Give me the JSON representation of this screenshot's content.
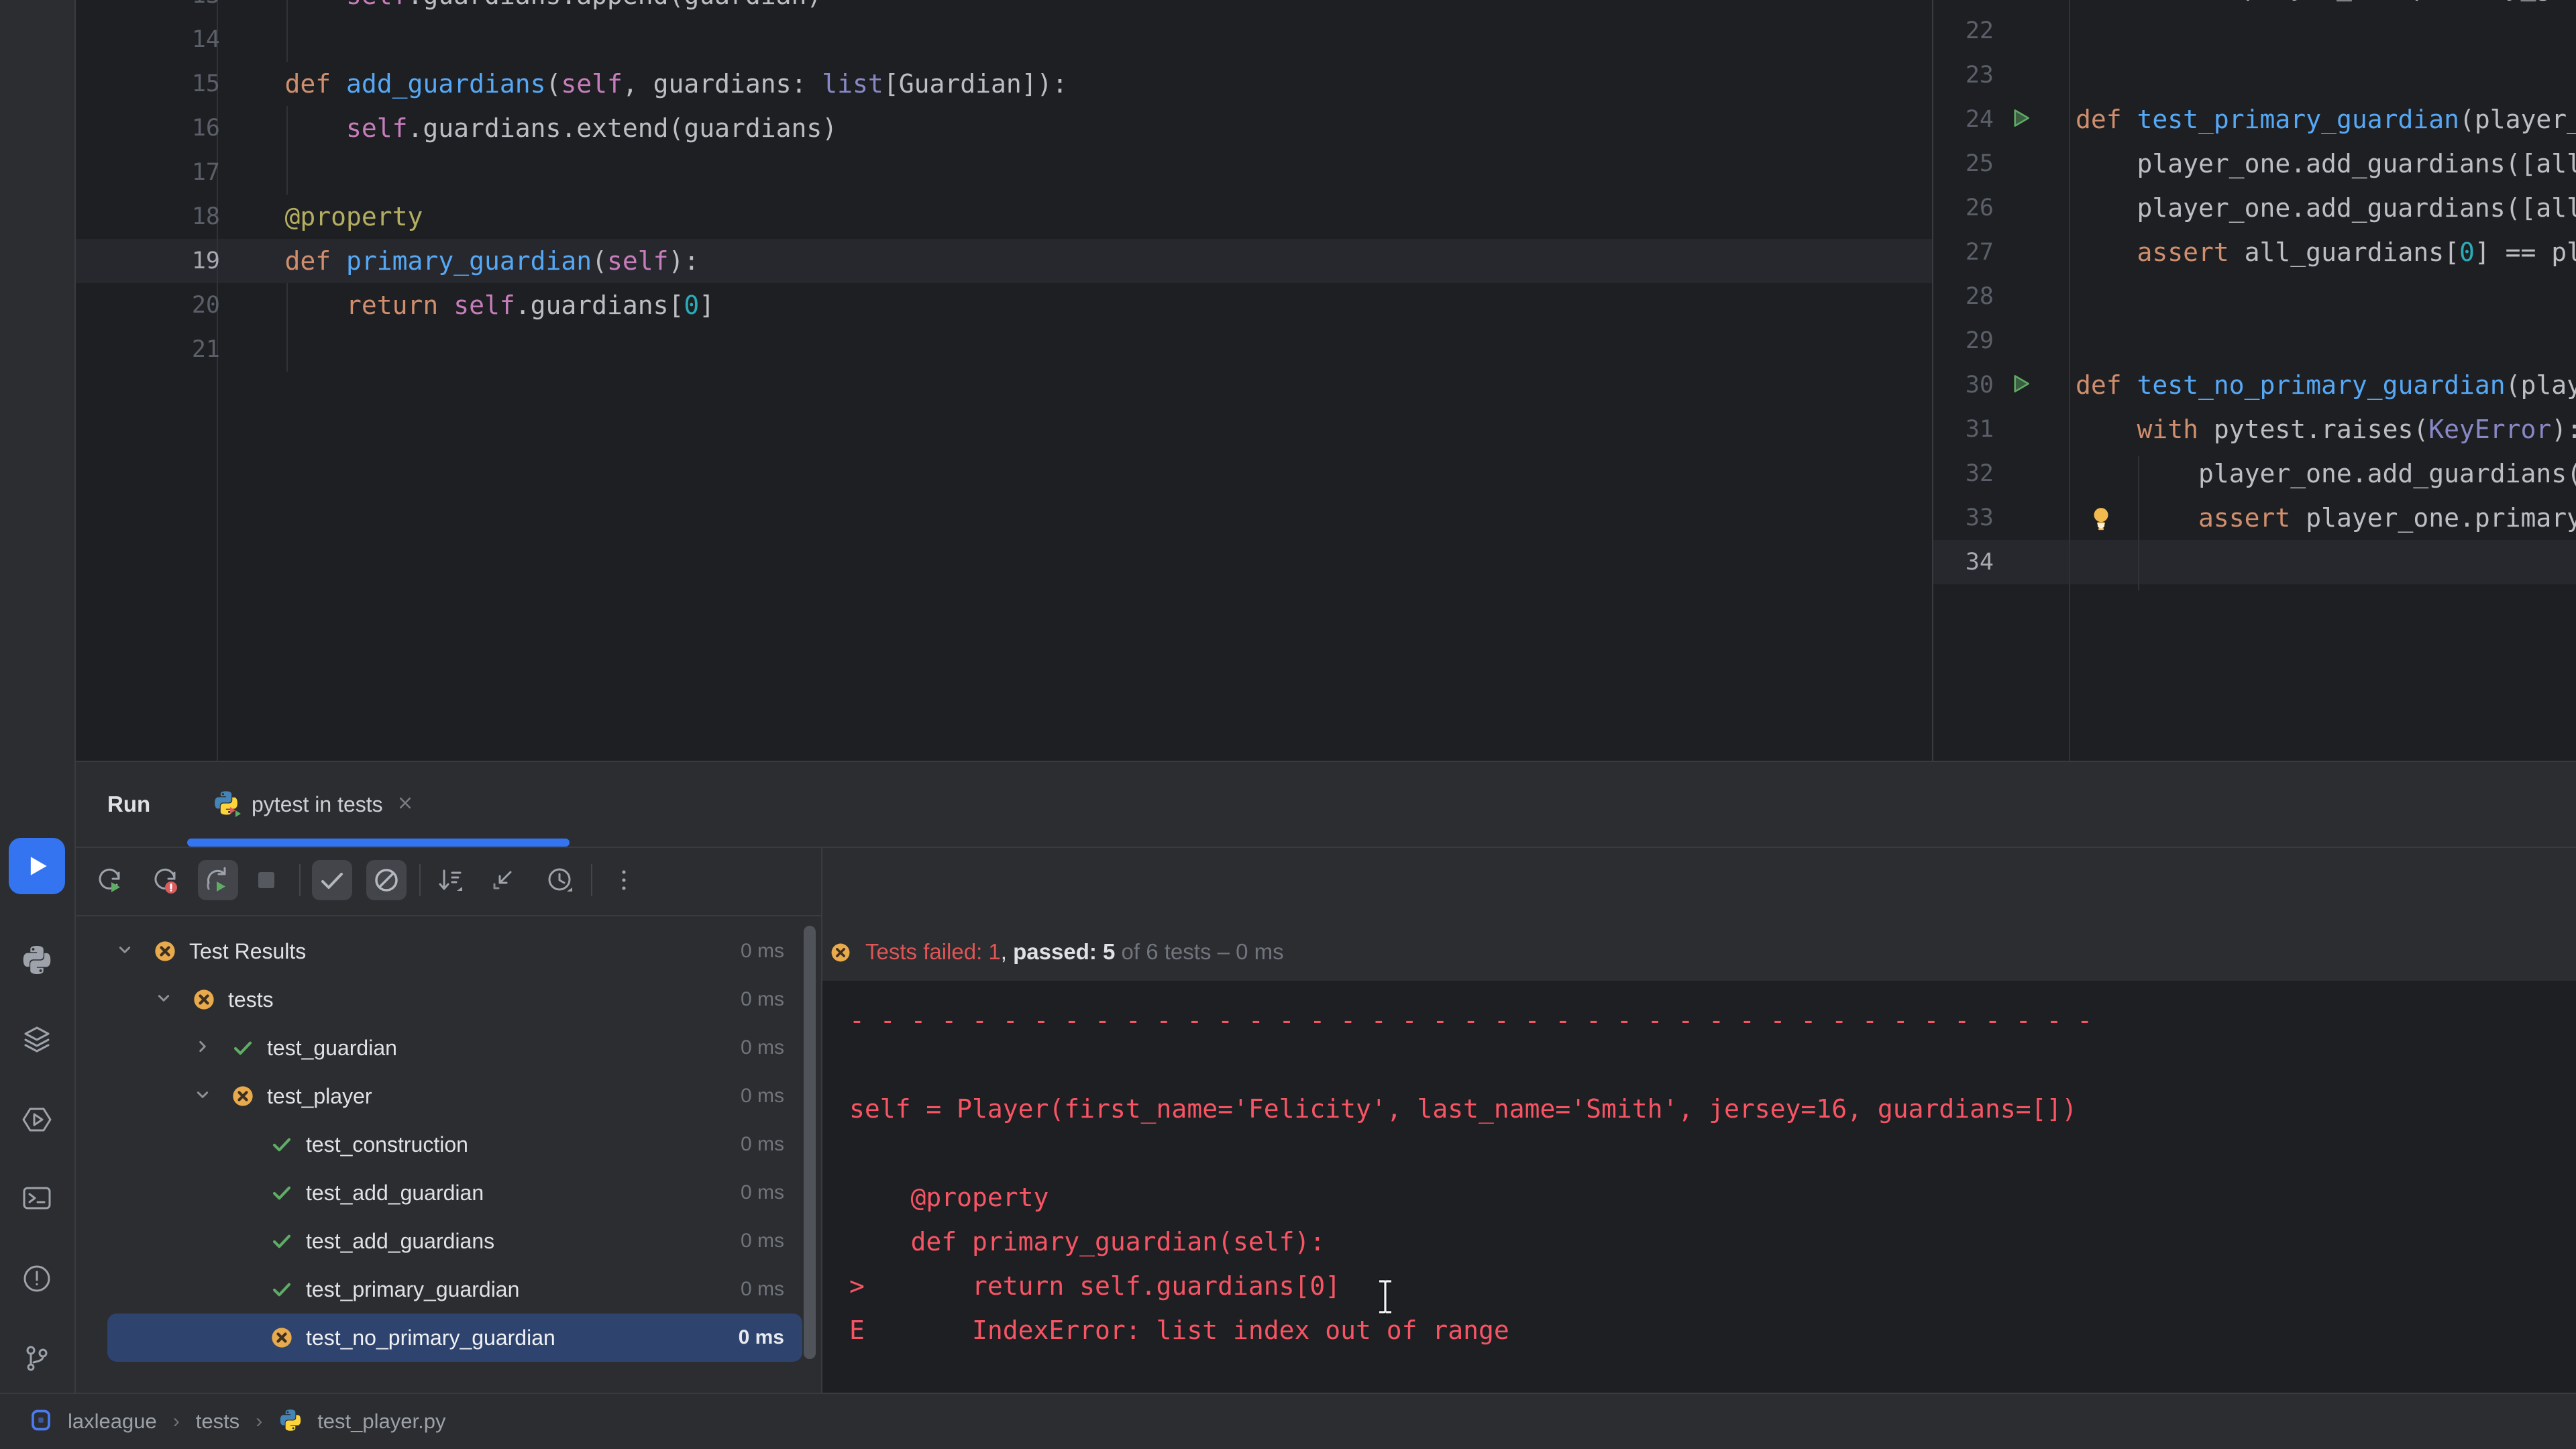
{
  "colors": {
    "accent": "#3574f0",
    "editor_bg": "#1e1f22",
    "panel_bg": "#2b2d30",
    "border": "#393b40",
    "caret_line": "#26282e",
    "selection_row": "#2e436e",
    "console_red": "#f75464",
    "status_red": "#e05555",
    "passed_green": "#5fad65",
    "failed_yellow": "#e8aa4c",
    "txt": "#bcbec4",
    "kw": "#cf8e6d",
    "fn": "#56a8f5",
    "self": "#c77dbb",
    "type": "#8888c6",
    "num": "#2aacb8",
    "dec": "#b3ae60",
    "line_number": "#5a5f69",
    "line_number_active": "#a7aab1"
  },
  "stripe": {
    "items": [
      {
        "name": "run",
        "icon": "run-icon",
        "active": true
      },
      {
        "name": "python-packages",
        "icon": "python-packages-icon"
      },
      {
        "name": "services",
        "icon": "services-icon"
      },
      {
        "name": "python-console",
        "icon": "python-console-icon"
      },
      {
        "name": "terminal",
        "icon": "terminal-icon"
      },
      {
        "name": "problems",
        "icon": "problems-icon"
      },
      {
        "name": "version-control",
        "icon": "git-branch-icon"
      }
    ]
  },
  "editor": {
    "left": {
      "caret_line": 19,
      "lines": [
        {
          "n": 13,
          "segs": [
            [
              "txt",
              "        "
            ],
            [
              "self",
              "self"
            ],
            [
              "txt",
              ".guardians.append(guardian)"
            ]
          ]
        },
        {
          "n": 14,
          "segs": []
        },
        {
          "n": 15,
          "segs": [
            [
              "txt",
              "    "
            ],
            [
              "kw",
              "def"
            ],
            [
              "txt",
              " "
            ],
            [
              "fn",
              "add_guardians"
            ],
            [
              "txt",
              "("
            ],
            [
              "self",
              "self"
            ],
            [
              "txt",
              ", guardians: "
            ],
            [
              "type",
              "list"
            ],
            [
              "txt",
              "[Guardian]):"
            ]
          ]
        },
        {
          "n": 16,
          "segs": [
            [
              "txt",
              "        "
            ],
            [
              "self",
              "self"
            ],
            [
              "txt",
              ".guardians.extend(guardians)"
            ]
          ]
        },
        {
          "n": 17,
          "segs": []
        },
        {
          "n": 18,
          "segs": [
            [
              "txt",
              "    "
            ],
            [
              "dec",
              "@property"
            ]
          ]
        },
        {
          "n": 19,
          "segs": [
            [
              "txt",
              "    "
            ],
            [
              "kw",
              "def"
            ],
            [
              "txt",
              " "
            ],
            [
              "fn",
              "primary_guardian"
            ],
            [
              "txt",
              "("
            ],
            [
              "self",
              "self"
            ],
            [
              "txt",
              "):"
            ]
          ]
        },
        {
          "n": 20,
          "segs": [
            [
              "txt",
              "        "
            ],
            [
              "kw",
              "return"
            ],
            [
              "txt",
              " "
            ],
            [
              "self",
              "self"
            ],
            [
              "txt",
              ".guardians["
            ],
            [
              "num",
              "0"
            ],
            [
              "txt",
              "]"
            ]
          ]
        },
        {
          "n": 21,
          "segs": []
        }
      ]
    },
    "right": {
      "caret_line": 34,
      "run_lines": [
        24,
        30
      ],
      "bulb_line": 33,
      "lines": [
        {
          "n": 21,
          "segs": [
            [
              "txt",
              "    "
            ],
            [
              "kw",
              "assert"
            ],
            [
              "txt",
              " player_one.primary_guardian == alice"
            ]
          ]
        },
        {
          "n": 22,
          "segs": []
        },
        {
          "n": 23,
          "segs": []
        },
        {
          "n": 24,
          "segs": [
            [
              "kw",
              "def"
            ],
            [
              "txt",
              " "
            ],
            [
              "fn",
              "test_primary_guardian"
            ],
            [
              "txt",
              "(player_one, all_guardians):"
            ]
          ]
        },
        {
          "n": 25,
          "segs": [
            [
              "txt",
              "    player_one.add_guardians([all_guardians["
            ],
            [
              "num",
              "0"
            ],
            [
              "txt",
              "]])"
            ]
          ]
        },
        {
          "n": 26,
          "segs": [
            [
              "txt",
              "    player_one.add_guardians([all_guardians["
            ],
            [
              "num",
              "1"
            ],
            [
              "txt",
              "]])"
            ]
          ]
        },
        {
          "n": 27,
          "segs": [
            [
              "txt",
              "    "
            ],
            [
              "kw",
              "assert"
            ],
            [
              "txt",
              " all_guardians["
            ],
            [
              "num",
              "0"
            ],
            [
              "txt",
              "] == player_one.primary_guardian"
            ]
          ]
        },
        {
          "n": 28,
          "segs": []
        },
        {
          "n": 29,
          "segs": []
        },
        {
          "n": 30,
          "segs": [
            [
              "kw",
              "def"
            ],
            [
              "txt",
              " "
            ],
            [
              "fn",
              "test_no_primary_guardian"
            ],
            [
              "txt",
              "(player_one):"
            ]
          ]
        },
        {
          "n": 31,
          "segs": [
            [
              "txt",
              "    "
            ],
            [
              "kw",
              "with"
            ],
            [
              "txt",
              " pytest.raises("
            ],
            [
              "type",
              "KeyError"
            ],
            [
              "txt",
              "):"
            ]
          ]
        },
        {
          "n": 32,
          "segs": [
            [
              "txt",
              "        player_one.add_guardians([])"
            ]
          ]
        },
        {
          "n": 33,
          "segs": [
            [
              "txt",
              "        "
            ],
            [
              "kw",
              "assert"
            ],
            [
              "txt",
              " player_one.primary_guardian"
            ]
          ]
        },
        {
          "n": 34,
          "segs": []
        }
      ]
    }
  },
  "run_panel": {
    "title": "Run",
    "tab": {
      "label": "pytest in tests"
    },
    "toolbar": [
      {
        "name": "rerun-tests-button",
        "icon": "rerun-icon"
      },
      {
        "name": "rerun-failed-tests-button",
        "icon": "rerun-failed-icon"
      },
      {
        "name": "toggle-auto-test-button",
        "icon": "auto-rerun-icon",
        "toggled": true
      },
      {
        "name": "stop-button",
        "icon": "stop-icon",
        "disabled": true
      },
      {
        "sep": true
      },
      {
        "name": "show-passed-button",
        "icon": "check-icon",
        "toggled": true
      },
      {
        "name": "show-ignored-button",
        "icon": "ignored-icon",
        "toggled": true
      },
      {
        "sep": true
      },
      {
        "name": "sort-tests-button",
        "icon": "sort-icon"
      },
      {
        "name": "collapse-all-button",
        "icon": "collapse-icon"
      },
      {
        "name": "test-history-button",
        "icon": "history-icon"
      },
      {
        "sep": true
      },
      {
        "name": "more-options-button",
        "icon": "more-icon"
      }
    ]
  },
  "tree": {
    "rows": [
      {
        "level": 0,
        "state": "failed",
        "chevron": "expanded",
        "label": "Test Results",
        "time": "0 ms"
      },
      {
        "level": 1,
        "state": "failed",
        "chevron": "expanded",
        "label": "tests",
        "time": "0 ms"
      },
      {
        "level": 2,
        "state": "passed",
        "chevron": "collapsed",
        "label": "test_guardian",
        "time": "0 ms"
      },
      {
        "level": 2,
        "state": "failed",
        "chevron": "expanded",
        "label": "test_player",
        "time": "0 ms"
      },
      {
        "level": 3,
        "state": "passed",
        "chevron": "none",
        "label": "test_construction",
        "time": "0 ms"
      },
      {
        "level": 3,
        "state": "passed",
        "chevron": "none",
        "label": "test_add_guardian",
        "time": "0 ms"
      },
      {
        "level": 3,
        "state": "passed",
        "chevron": "none",
        "label": "test_add_guardians",
        "time": "0 ms"
      },
      {
        "level": 3,
        "state": "passed",
        "chevron": "none",
        "label": "test_primary_guardian",
        "time": "0 ms"
      },
      {
        "level": 3,
        "state": "failed",
        "chevron": "none",
        "label": "test_no_primary_guardian",
        "time": "0 ms",
        "selected": true
      }
    ]
  },
  "console": {
    "status": {
      "failed": "Tests failed: 1",
      "sep": ", ",
      "passed": "passed: 5",
      "summary": " of 6 tests – 0 ms"
    },
    "lines": [
      "- - - - - - - - - - - - - - - - - - - - - - - - - - - - - - - - - - - - - - - - -",
      "",
      "self = Player(first_name='Felicity', last_name='Smith', jersey=16, guardians=[])",
      "",
      "    @property",
      "    def primary_guardian(self):",
      ">       return self.guardians[0]",
      "E       IndexError: list index out of range"
    ]
  },
  "statusbar": {
    "breadcrumbs": [
      "laxleague",
      "tests",
      "test_player.py"
    ]
  }
}
